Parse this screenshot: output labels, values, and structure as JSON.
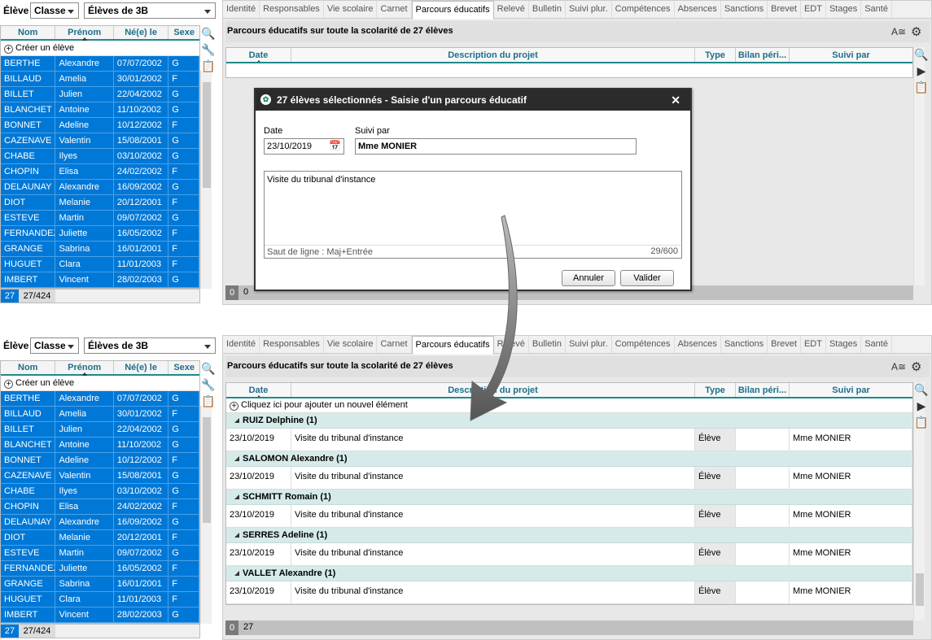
{
  "element_label": "Élève",
  "class_select": "Classe",
  "group_select": "Élèves de 3B",
  "student_headers": [
    "Nom",
    "Prénom",
    "Né(e) le",
    "Sexe"
  ],
  "create_student": "Créer un élève",
  "students": [
    [
      "BERTHE",
      "Alexandre",
      "07/07/2002",
      "G"
    ],
    [
      "BILLAUD",
      "Amelia",
      "30/01/2002",
      "F"
    ],
    [
      "BILLET",
      "Julien",
      "22/04/2002",
      "G"
    ],
    [
      "BLANCHET",
      "Antoine",
      "11/10/2002",
      "G"
    ],
    [
      "BONNET",
      "Adeline",
      "10/12/2002",
      "F"
    ],
    [
      "CAZENAVE",
      "Valentin",
      "15/08/2001",
      "G"
    ],
    [
      "CHABE",
      "Ilyes",
      "03/10/2002",
      "G"
    ],
    [
      "CHOPIN",
      "Elisa",
      "24/02/2002",
      "F"
    ],
    [
      "DELAUNAY",
      "Alexandre",
      "16/09/2002",
      "G"
    ],
    [
      "DIOT",
      "Melanie",
      "20/12/2001",
      "F"
    ],
    [
      "ESTEVE",
      "Martin",
      "09/07/2002",
      "G"
    ],
    [
      "FERNANDEZ",
      "Juliette",
      "16/05/2002",
      "F"
    ],
    [
      "GRANGE",
      "Sabrina",
      "16/01/2001",
      "F"
    ],
    [
      "HUGUET",
      "Clara",
      "11/01/2003",
      "F"
    ],
    [
      "IMBERT",
      "Vincent",
      "28/02/2003",
      "G"
    ]
  ],
  "selected_count": "27",
  "selection_total": "27/424",
  "tabs": [
    "Identité",
    "Responsables",
    "Vie scolaire",
    "Carnet",
    "Parcours éducatifs",
    "Relevé",
    "Bulletin",
    "Suivi plur.",
    "Compétences",
    "Absences",
    "Sanctions",
    "Brevet",
    "EDT",
    "Stages",
    "Santé"
  ],
  "active_tab": "Parcours éducatifs",
  "section_title": "Parcours éducatifs sur toute la scolarité de 27 élèves",
  "grid_headers": [
    "Date",
    "Description du projet",
    "Type",
    "Bilan péri...",
    "Suivi par"
  ],
  "top_footer": [
    "0",
    "0"
  ],
  "dialog": {
    "title": "27 élèves sélectionnés - Saisie d'un parcours éducatif",
    "date_label": "Date",
    "date_value": "23/10/2019",
    "followed_label": "Suivi par",
    "followed_value": "Mme MONIER",
    "description": "Visite du tribunal d'instance",
    "hint": "Saut de ligne : Maj+Entrée",
    "counter": "29/600",
    "cancel": "Annuler",
    "validate": "Valider"
  },
  "add_element": "Cliquez ici pour ajouter un nouvel élément",
  "entries": [
    {
      "group": "RUIZ Delphine (1)",
      "date": "23/10/2019",
      "description": "Visite du tribunal d'instance",
      "type": "Élève",
      "bilan": "",
      "followed": "Mme MONIER"
    },
    {
      "group": "SALOMON Alexandre (1)",
      "date": "23/10/2019",
      "description": "Visite du tribunal d'instance",
      "type": "Élève",
      "bilan": "",
      "followed": "Mme MONIER"
    },
    {
      "group": "SCHMITT Romain (1)",
      "date": "23/10/2019",
      "description": "Visite du tribunal d'instance",
      "type": "Élève",
      "bilan": "",
      "followed": "Mme MONIER"
    },
    {
      "group": "SERRES Adeline (1)",
      "date": "23/10/2019",
      "description": "Visite du tribunal d'instance",
      "type": "Élève",
      "bilan": "",
      "followed": "Mme MONIER"
    },
    {
      "group": "VALLET Alexandre (1)",
      "date": "23/10/2019",
      "description": "Visite du tribunal d'instance",
      "type": "Élève",
      "bilan": "",
      "followed": "Mme MONIER"
    }
  ],
  "bottom_footer": [
    "0",
    "27"
  ],
  "colors": {
    "selection": "#0078d7",
    "header_teal": "#1e8a8a",
    "group_row": "#d6eaea",
    "dialog_title": "#2b2b2b"
  }
}
